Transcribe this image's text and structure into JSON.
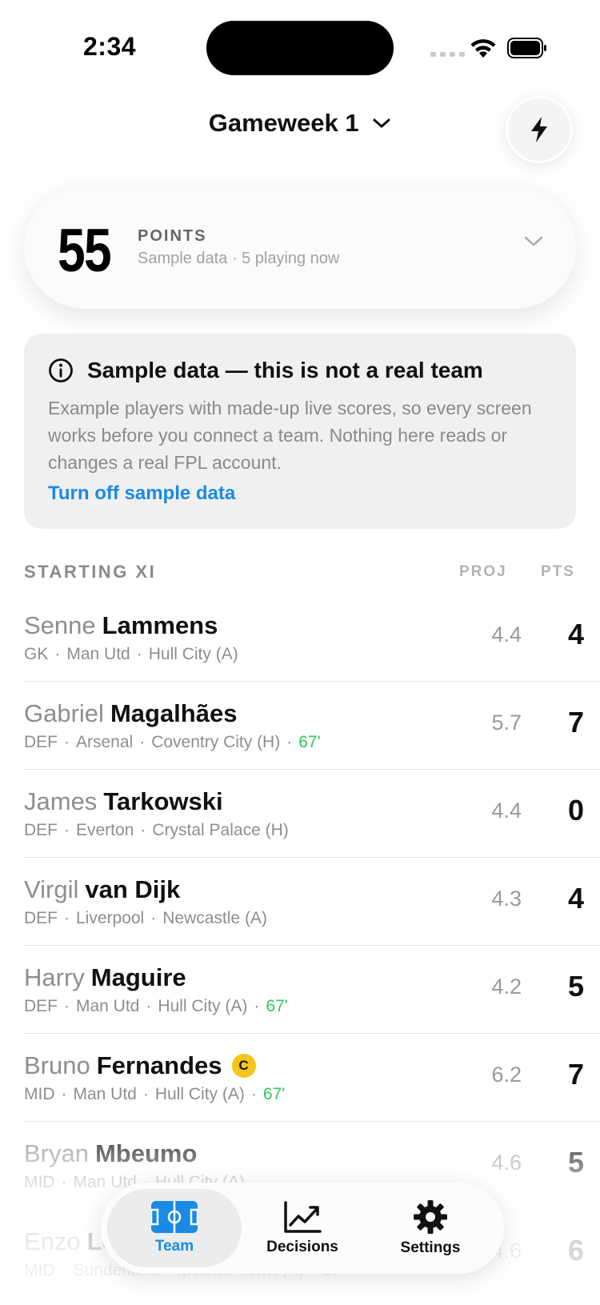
{
  "status_bar": {
    "time": "2:34"
  },
  "header": {
    "title": "Gameweek 1",
    "chevron_icon": "chevron-down-icon",
    "action_icon": "bolt-icon"
  },
  "points_card": {
    "value": "55",
    "label": "POINTS",
    "subtitle": "Sample data · 5 playing now"
  },
  "info_card": {
    "title": "Sample data — this is not a real team",
    "body": "Example players with made-up live scores, so every screen works before you connect a team. Nothing here reads or changes a real FPL account.",
    "link": "Turn off sample data"
  },
  "section": {
    "title": "STARTING XI",
    "col_proj": "PROJ",
    "col_pts": "PTS"
  },
  "players": [
    {
      "first": "Senne",
      "last": "Lammens",
      "pos": "GK",
      "club": "Man Utd",
      "fixture": "Hull City (A)",
      "live": "",
      "proj": "4.4",
      "pts": "4",
      "captain": ""
    },
    {
      "first": "Gabriel",
      "last": "Magalhães",
      "pos": "DEF",
      "club": "Arsenal",
      "fixture": "Coventry City (H)",
      "live": "67'",
      "proj": "5.7",
      "pts": "7",
      "captain": ""
    },
    {
      "first": "James",
      "last": "Tarkowski",
      "pos": "DEF",
      "club": "Everton",
      "fixture": "Crystal Palace (H)",
      "live": "",
      "proj": "4.4",
      "pts": "0",
      "captain": ""
    },
    {
      "first": "Virgil",
      "last": "van Dijk",
      "pos": "DEF",
      "club": "Liverpool",
      "fixture": "Newcastle (A)",
      "live": "",
      "proj": "4.3",
      "pts": "4",
      "captain": ""
    },
    {
      "first": "Harry",
      "last": "Maguire",
      "pos": "DEF",
      "club": "Man Utd",
      "fixture": "Hull City (A)",
      "live": "67'",
      "proj": "4.2",
      "pts": "5",
      "captain": ""
    },
    {
      "first": "Bruno",
      "last": "Fernandes",
      "pos": "MID",
      "club": "Man Utd",
      "fixture": "Hull City (A)",
      "live": "67'",
      "proj": "6.2",
      "pts": "7",
      "captain": "C"
    },
    {
      "first": "Bryan",
      "last": "Mbeumo",
      "pos": "MID",
      "club": "Man Utd",
      "fixture": "Hull City (A)",
      "live": "",
      "proj": "4.6",
      "pts": "5",
      "captain": ""
    },
    {
      "first": "Enzo",
      "last": "Le Fée",
      "pos": "MID",
      "club": "Sunderland",
      "fixture": "Ipswich Town (A)",
      "live": "67'",
      "proj": "4.6",
      "pts": "6",
      "captain": ""
    }
  ],
  "tab_bar": {
    "tabs": [
      {
        "label": "Team",
        "icon": "pitch-icon",
        "active": true
      },
      {
        "label": "Decisions",
        "icon": "trend-chart-icon",
        "active": false
      },
      {
        "label": "Settings",
        "icon": "gear-icon",
        "active": false
      }
    ]
  },
  "colors": {
    "accent": "#1a8ae6",
    "live": "#34c759",
    "captain": "#f5c518"
  }
}
